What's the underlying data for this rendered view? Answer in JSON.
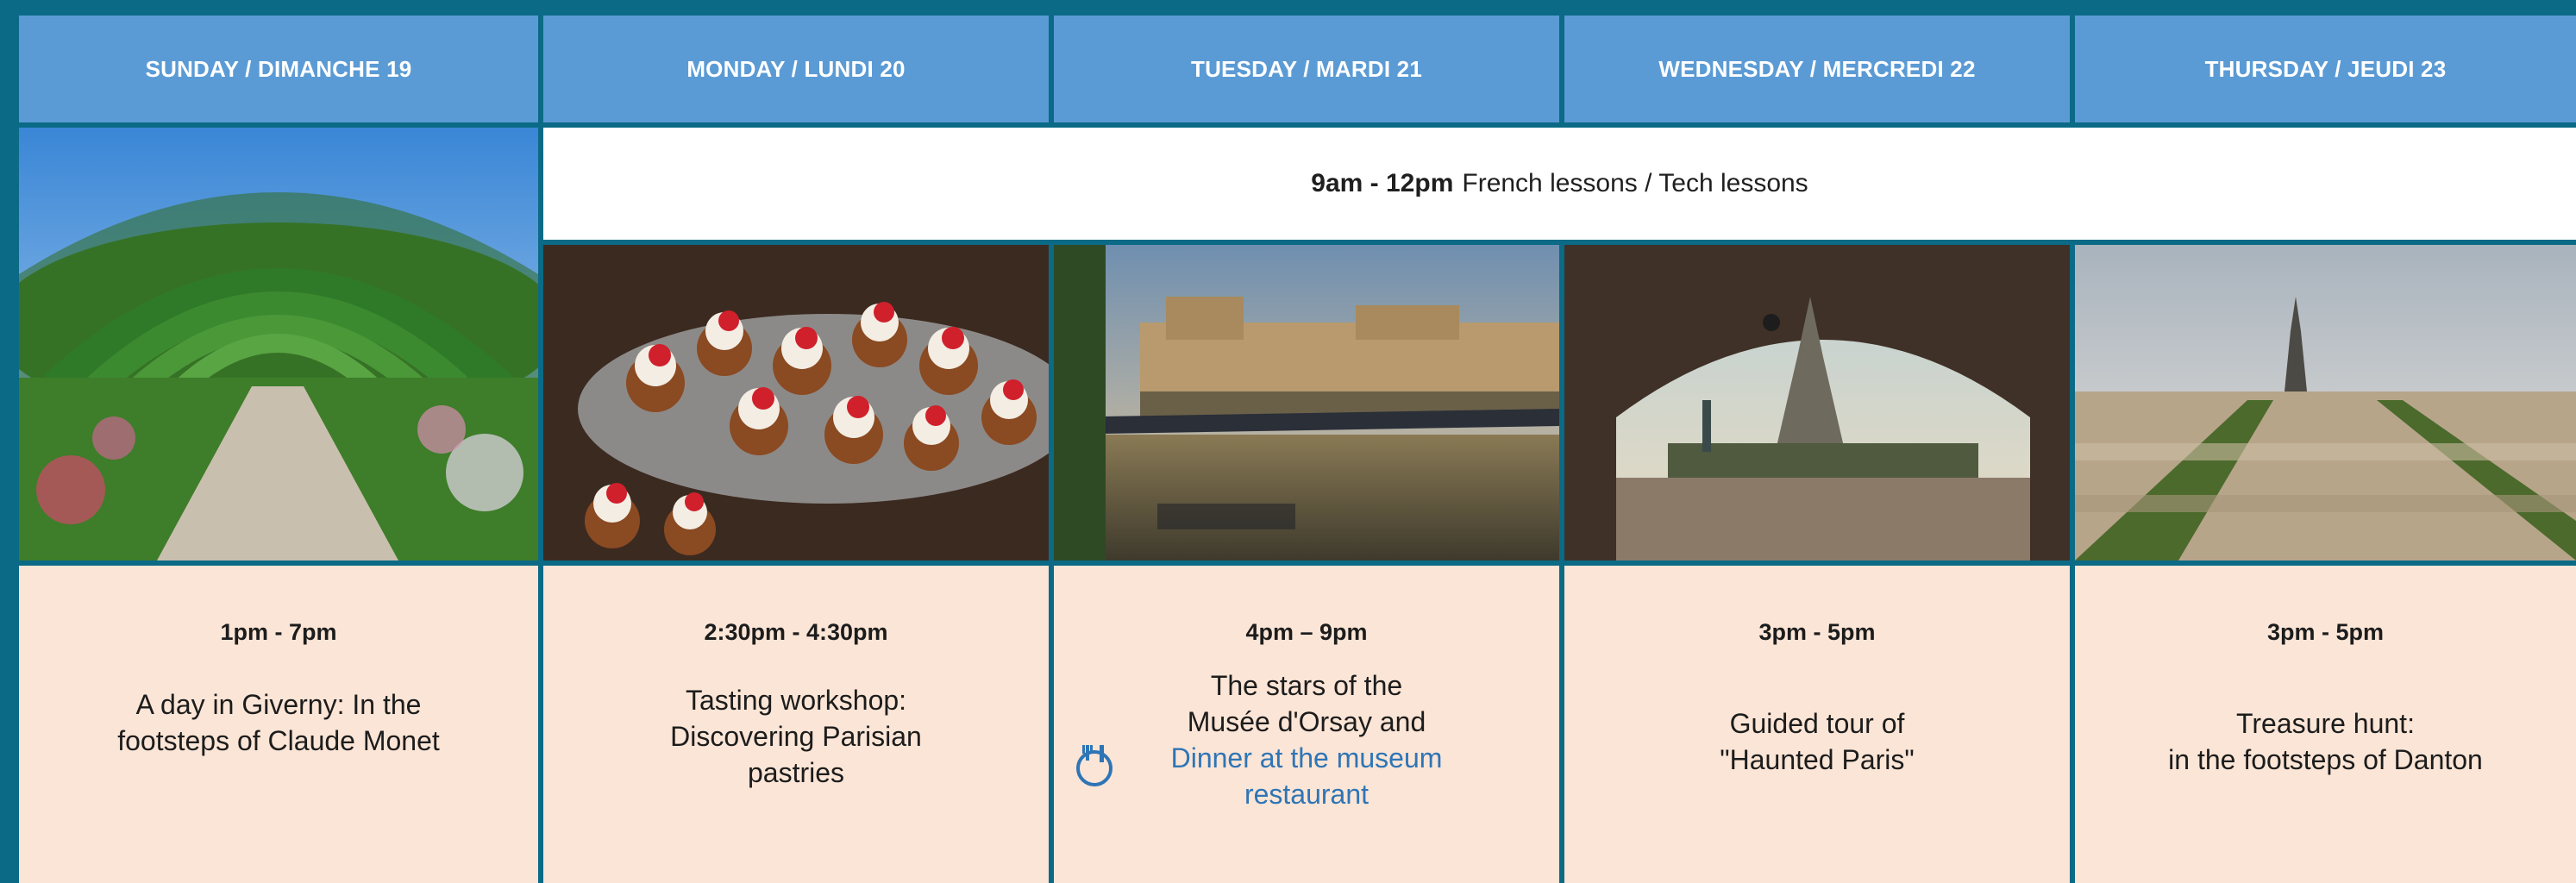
{
  "days": [
    {
      "header": "SUNDAY / DIMANCHE 19",
      "time": "1pm - 7pm",
      "desc": [
        "A day in Giverny: In the",
        "footsteps of Claude Monet"
      ]
    },
    {
      "header": "MONDAY / LUNDI 20",
      "time": "2:30pm - 4:30pm",
      "desc": [
        "Tasting workshop:",
        "Discovering Parisian",
        "pastries"
      ]
    },
    {
      "header": "TUESDAY / MARDI 21",
      "time": "4pm – 9pm",
      "desc": [
        "The stars of the",
        "Musée d'Orsay and"
      ],
      "desc_link": [
        "Dinner at the museum",
        "restaurant"
      ]
    },
    {
      "header": "WEDNESDAY / MERCREDI 22",
      "time": "3pm - 5pm",
      "desc": [
        "Guided tour of",
        "\"Haunted Paris\""
      ]
    },
    {
      "header": "THURSDAY / JEUDI 23",
      "time": "3pm - 5pm",
      "desc": [
        "Treasure hunt:",
        "in the footsteps of Danton"
      ]
    }
  ],
  "lessons": {
    "time": "9am - 12pm",
    "text": "French lessons / Tech lessons"
  },
  "icons": {
    "dinner": "fork-knife-plate-icon"
  },
  "colors": {
    "frame": "#0b6a86",
    "header_bg": "#5b9bd5",
    "header_text": "#ffffff",
    "activity_bg": "#fbe5d6",
    "link": "#2e75b6"
  }
}
